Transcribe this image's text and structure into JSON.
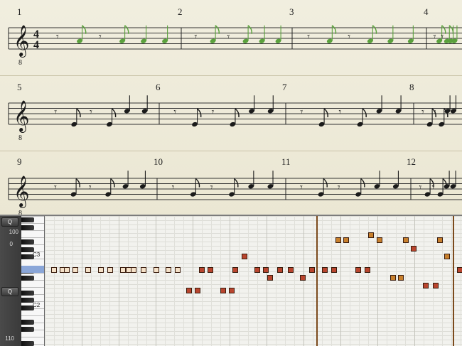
{
  "score": {
    "time_signature": {
      "top": "4",
      "bottom": "4"
    },
    "clef_octave": "8",
    "systems": [
      {
        "measures": [
          "1",
          "2",
          "3",
          "4"
        ]
      },
      {
        "measures": [
          "5",
          "6",
          "7",
          "8"
        ]
      },
      {
        "measures": [
          "9",
          "10",
          "11",
          "12"
        ]
      }
    ],
    "colors": {
      "highlight": "#5aa13c",
      "ink": "#1a1a1a"
    }
  },
  "piano_roll": {
    "sidebar": {
      "buttons": [
        "Q",
        "Q"
      ],
      "values": [
        "100",
        "0",
        "110"
      ]
    },
    "keyboard_labels": [
      "C3",
      "C2"
    ],
    "colors": {
      "note_light": "#f5e1c8",
      "note_dark_red": "#b9452e",
      "note_orange": "#c8802d",
      "playhead": "#7b4a1c"
    }
  }
}
